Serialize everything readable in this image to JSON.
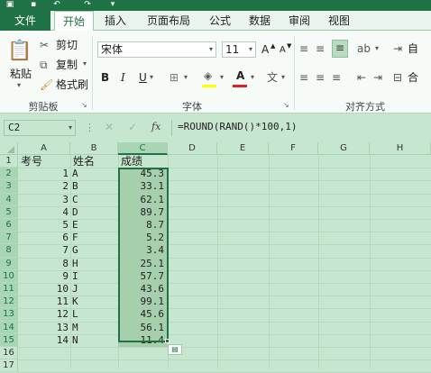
{
  "ribbon_tabs": [
    "文件",
    "开始",
    "插入",
    "页面布局",
    "公式",
    "数据",
    "审阅",
    "视图"
  ],
  "clipboard": {
    "paste": "粘贴",
    "cut": "剪切",
    "copy": "复制",
    "format_painter": "格式刷",
    "label": "剪贴板"
  },
  "font": {
    "name": "宋体",
    "size": "11",
    "bold": "B",
    "italic": "I",
    "underline": "U",
    "grow": "A",
    "shrink": "A",
    "font_color": "A",
    "label": "字体"
  },
  "alignment": {
    "wrap": "自",
    "merge": "合",
    "label": "对齐方式"
  },
  "name_box": "C2",
  "formula": "=ROUND(RAND()*100,1)",
  "fx": "fx",
  "columns": [
    "A",
    "B",
    "C",
    "D",
    "E",
    "F",
    "G",
    "H"
  ],
  "row_numbers": [
    "1",
    "2",
    "3",
    "4",
    "5",
    "6",
    "7",
    "8",
    "9",
    "10",
    "11",
    "12",
    "13",
    "14",
    "15",
    "16",
    "17"
  ],
  "header": [
    "考号",
    "姓名",
    "成绩"
  ],
  "rows": [
    [
      "1",
      "A",
      "45.3"
    ],
    [
      "2",
      "B",
      "33.1"
    ],
    [
      "3",
      "C",
      "62.1"
    ],
    [
      "4",
      "D",
      "89.7"
    ],
    [
      "5",
      "E",
      "8.7"
    ],
    [
      "6",
      "F",
      "5.2"
    ],
    [
      "7",
      "G",
      "3.4"
    ],
    [
      "8",
      "H",
      "25.1"
    ],
    [
      "9",
      "I",
      "57.7"
    ],
    [
      "10",
      "J",
      "43.6"
    ],
    [
      "11",
      "K",
      "99.1"
    ],
    [
      "12",
      "L",
      "45.6"
    ],
    [
      "13",
      "M",
      "56.1"
    ],
    [
      "14",
      "N",
      "11.4"
    ]
  ],
  "colors": {
    "accent": "#1f7245",
    "sheet_bg": "#c7e6cf",
    "selection": "#a6cfae"
  }
}
